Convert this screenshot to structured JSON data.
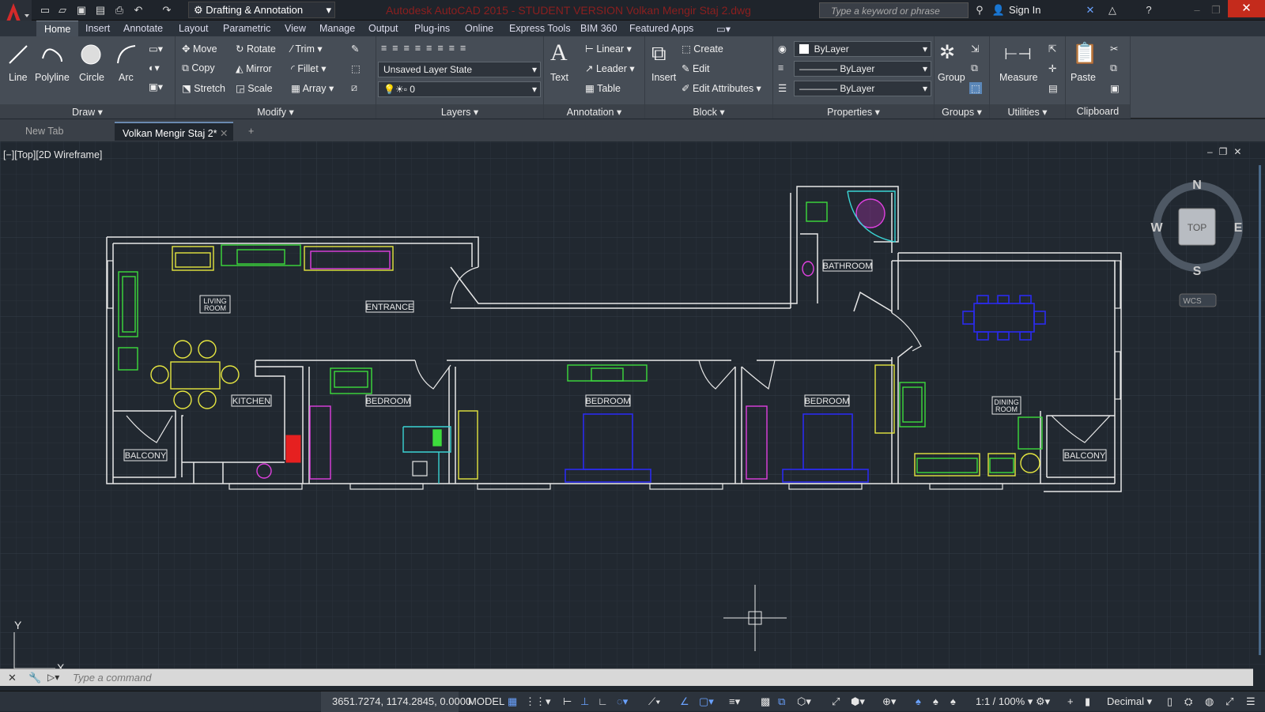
{
  "app": {
    "title": "Autodesk AutoCAD 2015 - STUDENT VERSION    Volkan Mengir Staj 2.dwg",
    "workspace": "Drafting & Annotation",
    "search_placeholder": "Type a keyword or phrase",
    "sign_in": "Sign In"
  },
  "menu_tabs": [
    "Home",
    "Insert",
    "Annotate",
    "Layout",
    "Parametric",
    "View",
    "Manage",
    "Output",
    "Plug-ins",
    "Online",
    "Express Tools",
    "BIM 360",
    "Featured Apps"
  ],
  "ribbon": {
    "draw": {
      "title": "Draw",
      "line": "Line",
      "polyline": "Polyline",
      "circle": "Circle",
      "arc": "Arc"
    },
    "modify": {
      "title": "Modify",
      "move": "Move",
      "rotate": "Rotate",
      "trim": "Trim",
      "copy": "Copy",
      "mirror": "Mirror",
      "fillet": "Fillet",
      "stretch": "Stretch",
      "scale": "Scale",
      "array": "Array"
    },
    "layers": {
      "title": "Layers",
      "layer_state": "Unsaved Layer State",
      "current_layer": "0"
    },
    "annotation": {
      "title": "Annotation",
      "text": "Text",
      "linear": "Linear",
      "leader": "Leader",
      "table": "Table"
    },
    "block": {
      "title": "Block",
      "insert": "Insert",
      "create": "Create",
      "edit": "Edit",
      "edit_attributes": "Edit Attributes"
    },
    "properties": {
      "title": "Properties",
      "color": "ByLayer",
      "linetype": "ByLayer",
      "lineweight": "ByLayer"
    },
    "groups": {
      "title": "Groups",
      "group": "Group"
    },
    "utilities": {
      "title": "Utilities",
      "measure": "Measure"
    },
    "clipboard": {
      "title": "Clipboard",
      "paste": "Paste"
    }
  },
  "doc_tabs": [
    "New Tab",
    "Volkan Mengir Staj 2*"
  ],
  "viewport": {
    "label": "[−][Top][2D Wireframe]",
    "viewcube": {
      "top": "TOP",
      "n": "N",
      "s": "S",
      "e": "E",
      "w": "W",
      "wcs": "WCS"
    },
    "rooms": [
      "LIVING ROOM",
      "ENTRANCE",
      "KITCHEN",
      "BEDROOM",
      "BEDROOM",
      "BEDROOM",
      "BATHROOM",
      "DINING ROOM",
      "BALCONY",
      "BALCONY"
    ],
    "axis_y": "Y",
    "axis_x": "X"
  },
  "command": {
    "placeholder": "Type a command"
  },
  "status": {
    "coords": "3651.7274, 1174.2845, 0.0000",
    "model": "MODEL",
    "scale": "1:1 / 100%",
    "units": "Decimal"
  },
  "colors": {
    "yellow": "#e6e640",
    "green": "#3ddc3d",
    "magenta": "#e040e0",
    "blue": "#2a2aee",
    "cyan": "#3ad4d4",
    "red": "#e62020",
    "wall": "#e8e8e8"
  }
}
